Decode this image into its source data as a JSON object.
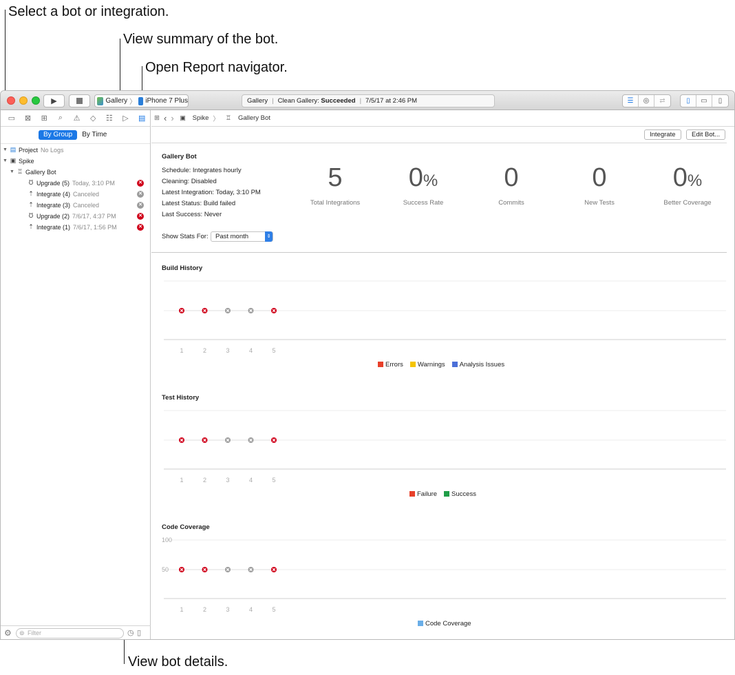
{
  "callouts": {
    "select_bot": "Select a bot or integration.",
    "view_summary": "View summary of the bot.",
    "open_report": "Open Report navigator.",
    "view_details": "View bot details."
  },
  "toolbar": {
    "scheme_project": "Gallery",
    "scheme_device": "iPhone 7 Plus",
    "activity_project": "Gallery",
    "activity_action": "Clean Gallery:",
    "activity_status": "Succeeded",
    "activity_time": "7/5/17 at 2:46 PM"
  },
  "navigator": {
    "seg_by_group": "By Group",
    "seg_by_time": "By Time",
    "project_label": "Project",
    "project_note": "No Logs",
    "spike_label": "Spike",
    "bot_label": "Gallery Bot",
    "items": [
      {
        "name": "Upgrade (5)",
        "time": "Today, 3:10 PM",
        "status": "error"
      },
      {
        "name": "Integrate (4)",
        "time": "Canceled",
        "status": "canceled"
      },
      {
        "name": "Integrate (3)",
        "time": "Canceled",
        "status": "canceled"
      },
      {
        "name": "Upgrade (2)",
        "time": "7/6/17, 4:37 PM",
        "status": "error"
      },
      {
        "name": "Integrate (1)",
        "time": "7/6/17, 1:56 PM",
        "status": "error"
      }
    ],
    "filter_placeholder": "Filter"
  },
  "jumpbar": {
    "crumb1": "Spike",
    "crumb2": "Gallery Bot"
  },
  "actions": {
    "integrate": "Integrate",
    "edit_bot": "Edit Bot..."
  },
  "summary": {
    "title": "Gallery Bot",
    "schedule": "Schedule: Integrates hourly",
    "cleaning": "Cleaning: Disabled",
    "latest_integration": "Latest Integration: Today, 3:10 PM",
    "latest_status": "Latest Status: Build failed",
    "last_success": "Last Success: Never",
    "show_stats_label": "Show Stats For:",
    "show_stats_value": "Past month"
  },
  "stats": [
    {
      "value": "5",
      "unit": "",
      "label": "Total Integrations"
    },
    {
      "value": "0",
      "unit": "%",
      "label": "Success Rate"
    },
    {
      "value": "0",
      "unit": "",
      "label": "Commits"
    },
    {
      "value": "0",
      "unit": "",
      "label": "New Tests"
    },
    {
      "value": "0",
      "unit": "%",
      "label": "Better Coverage"
    }
  ],
  "colors": {
    "error": "#d0021b",
    "canceled": "#9b9b9b",
    "accent": "#1b78e6",
    "errors_legend": "#e8402a",
    "warnings_legend": "#f5c400",
    "analysis_legend": "#4b6fd8",
    "failure_legend": "#e8402a",
    "success_legend": "#1f9e48",
    "coverage_legend": "#6aaee8"
  },
  "chart_data": [
    {
      "type": "scatter",
      "title": "Build History",
      "x": [
        1,
        2,
        3,
        4,
        5
      ],
      "status": [
        "error",
        "error",
        "canceled",
        "canceled",
        "error"
      ],
      "legend": [
        "Errors",
        "Warnings",
        "Analysis Issues"
      ]
    },
    {
      "type": "scatter",
      "title": "Test History",
      "x": [
        1,
        2,
        3,
        4,
        5
      ],
      "status": [
        "error",
        "error",
        "canceled",
        "canceled",
        "error"
      ],
      "legend": [
        "Failure",
        "Success"
      ]
    },
    {
      "type": "scatter",
      "title": "Code Coverage",
      "x": [
        1,
        2,
        3,
        4,
        5
      ],
      "y": [
        50,
        50,
        50,
        50,
        50
      ],
      "y_ticks": [
        "100",
        "50"
      ],
      "status": [
        "error",
        "error",
        "canceled",
        "canceled",
        "error"
      ],
      "legend": [
        "Code Coverage"
      ]
    }
  ]
}
